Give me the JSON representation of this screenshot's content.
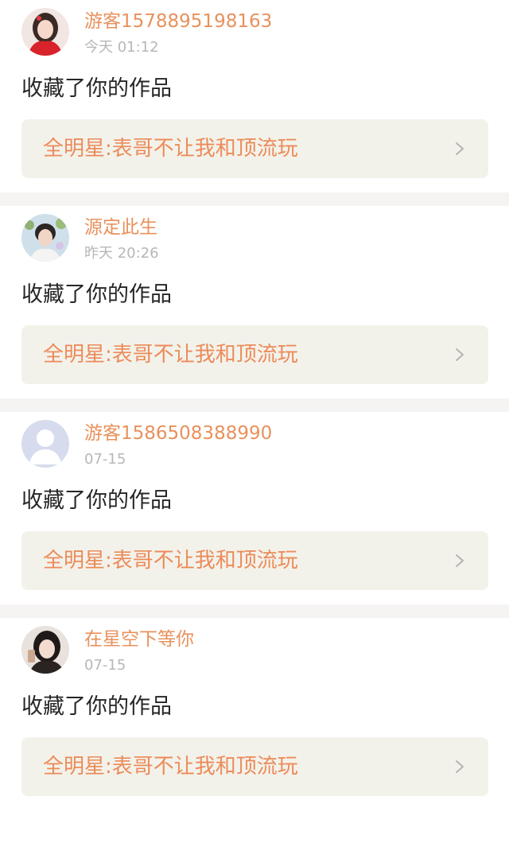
{
  "notifications": [
    {
      "username": "游客1578895198163",
      "time": "今天 01:12",
      "action": "收藏了你的作品",
      "work_title": "全明星:表哥不让我和顶流玩",
      "avatar": "avatar-girl-red-dress"
    },
    {
      "username": "源定此生",
      "time": "昨天 20:26",
      "action": "收藏了你的作品",
      "work_title": "全明星:表哥不让我和顶流玩",
      "avatar": "avatar-boy-flowers"
    },
    {
      "username": "游客1586508388990",
      "time": "07-15",
      "action": "收藏了你的作品",
      "work_title": "全明星:表哥不让我和顶流玩",
      "avatar": "default-user-icon"
    },
    {
      "username": "在星空下等你",
      "time": "07-15",
      "action": "收藏了你的作品",
      "work_title": "全明星:表哥不让我和顶流玩",
      "avatar": "avatar-girl-dark-hair"
    }
  ],
  "colors": {
    "username": "#e8915c",
    "work_title": "#ec8b5a",
    "card_background": "#f3f2ea",
    "time": "#b7b7b7",
    "divider": "#f6f4f3"
  }
}
